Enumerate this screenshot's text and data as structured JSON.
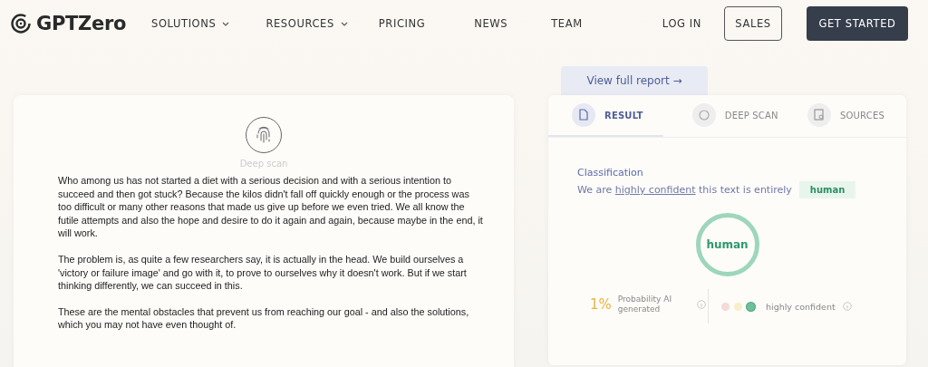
{
  "header": {
    "logo": "GPTZero",
    "nav": [
      {
        "label": "SOLUTIONS",
        "dropdown": true
      },
      {
        "label": "RESOURCES",
        "dropdown": true
      },
      {
        "label": "PRICING",
        "dropdown": false
      },
      {
        "label": "NEWS",
        "dropdown": false
      },
      {
        "label": "TEAM",
        "dropdown": false
      }
    ],
    "login": "LOG IN",
    "sales": "SALES",
    "cta": "GET STARTED"
  },
  "text_panel": {
    "scan_label": "Deep scan",
    "paragraphs": [
      "Who among us has not started a diet with a serious decision and with a serious intention to succeed and then got stuck? Because the kilos didn't fall off quickly enough or the process was too difficult or many other reasons that made us give up before we even tried. We all know the futile attempts and also the hope and desire to do it again and again, because maybe in the end, it will work.",
      "The problem is, as quite a few researchers say, it is actually in the head. We build ourselves a 'victory or failure image' and go with it, to prove to ourselves why it doesn't work. But if we start thinking differently, we can succeed in this.",
      "These are the mental obstacles that prevent us from reaching our goal - and also the solutions, which you may not have even thought of."
    ]
  },
  "report_link": "View full report →",
  "result_panel": {
    "tabs": [
      {
        "kind": "result",
        "label": "RESULT",
        "selected": true
      },
      {
        "kind": "scan",
        "label": "DEEP SCAN",
        "selected": false
      },
      {
        "kind": "sources",
        "label": "SOURCES",
        "selected": false
      }
    ],
    "classification_title": "Classification",
    "sentence_start": "We are",
    "sentence_link": "highly confident",
    "sentence_end": "this text is entirely",
    "verdict_tag": "human",
    "ring_label": "human",
    "probability": "1%",
    "probability_label": "Probability AI generated",
    "confidence_dots": [
      {
        "color": "#f6d9d9",
        "selected": false
      },
      {
        "color": "#f7efc9",
        "selected": false
      },
      {
        "color": "#6fbf98",
        "selected": true
      }
    ],
    "confidence_label": "highly confident"
  }
}
